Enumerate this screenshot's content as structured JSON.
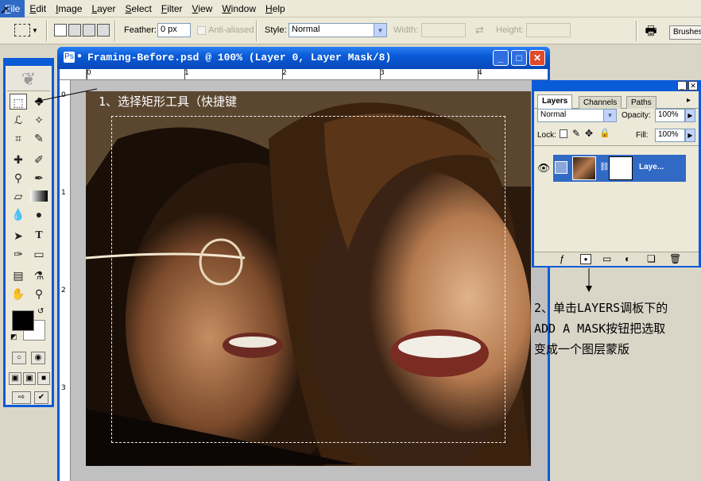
{
  "menu": [
    "File",
    "Edit",
    "Image",
    "Layer",
    "Select",
    "Filter",
    "View",
    "Window",
    "Help"
  ],
  "options": {
    "feather_label": "Feather:",
    "feather_value": "0 px",
    "anti_aliased": "Anti-aliased",
    "style_label": "Style:",
    "style_value": "Normal",
    "width_label": "Width:",
    "height_label": "Height:",
    "brushes": "Brushes"
  },
  "document": {
    "title": "Framing-Before.psd @ 100% (Layer 0, Layer Mask/8)",
    "ruler_h": [
      "0",
      "1",
      "2",
      "3",
      "4"
    ],
    "ruler_v": [
      "0",
      "1",
      "2",
      "3"
    ]
  },
  "layers_panel": {
    "tabs": [
      "Layers",
      "Channels",
      "Paths"
    ],
    "blend_mode": "Normal",
    "opacity_label": "Opacity:",
    "opacity_value": "100%",
    "lock_label": "Lock:",
    "fill_label": "Fill:",
    "fill_value": "100%",
    "layer_name": "Laye..."
  },
  "annotations": {
    "step1": "1、选择矩形工具（快捷键",
    "step2_line1": "2、单击LAYERS调板下的",
    "step2_line2": "ADD A MASK按钮把选取",
    "step2_line3": "变成一个图层蒙版"
  },
  "colors": {
    "xp_blue": "#0a5bd8",
    "selection": "#316ac5"
  }
}
